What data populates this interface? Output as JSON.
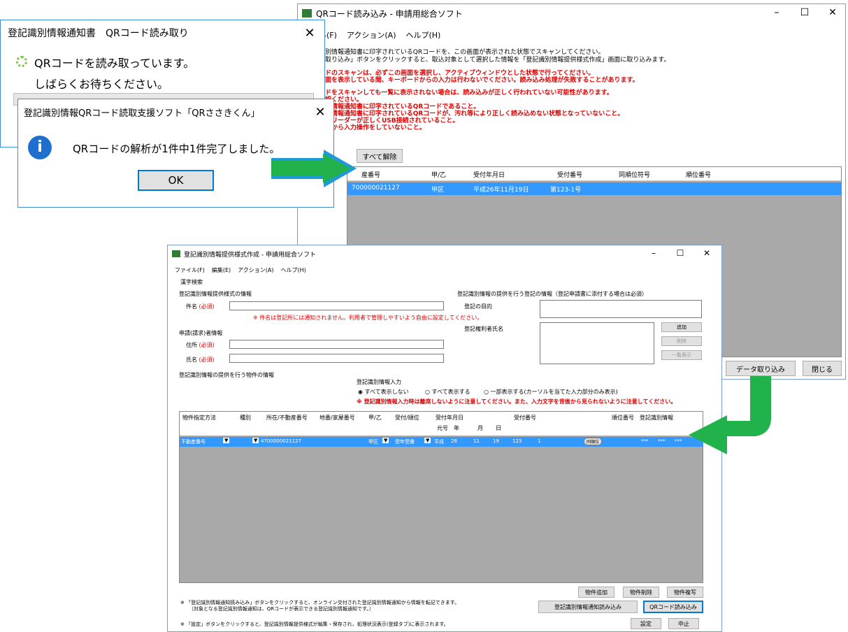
{
  "qr_window": {
    "title": "QRコード読み込み - 申請用総合ソフト",
    "menu": [
      "ル(F)",
      "アクション(A)",
      "ヘルプ(H)"
    ],
    "instructions": [
      "識別情報通知書に印字されているQRコードを、この画面が表示された状態でスキャンしてください。",
      "タ取り込み」ボタンをクリックすると、取込対象として選択した情報を「登記識別情報提供様式作成」画面に取り込みます。"
    ],
    "warnings": [
      "ードのスキャンは、必ずこの画面を選択し、アクティブウィンドウとした状態で行ってください。",
      "画面を表示している間、キーボードからの入力は行わないでください。読み込み処理が失敗することがあります。",
      "ードをスキャンしても一覧に表示されない場合は、読み込みが正しく行われていない可能性があります。",
      "確認ください。",
      "識別情報通知書に印字されているQRコードであること。",
      "識別情報通知書に印字されているQRコードが、汚れ等により正しく読み込めない状態となっていないこと。",
      "ードリーダーが正しくUSB接続されていること。",
      "ードから入力操作をしていないこと。"
    ],
    "unselect_all": "すべて解除",
    "columns": [
      "産番号",
      "甲/乙",
      "受付年月日",
      "受付番号",
      "同順位符号",
      "順位番号"
    ],
    "row": [
      "700000021127",
      "甲区",
      "平成26年11月19日",
      "第123-1号",
      "",
      ""
    ],
    "import_button": "データ取り込み",
    "close_button": "閉じる"
  },
  "progress_dialog": {
    "title": "登記識別情報通知書　QRコード読み取り",
    "line1": "QRコードを読み取っています。",
    "line2": "しばらくお待ちください。"
  },
  "msg_dialog": {
    "title": "登記識別情報QRコード読取支援ソフト「QRささきくん」",
    "message": "QRコードの解析が1件中1件完了しました。",
    "ok": "OK"
  },
  "form_window": {
    "title": "登記識別情報提供様式作成 - 申請用総合ソフト",
    "menu": [
      "ファイル(F)",
      "編集(E)",
      "アクション(A)",
      "ヘルプ(H)"
    ],
    "kanji_search": "漢字検索",
    "section_info": "登記識別情報提供様式の情報",
    "label_name": "件名",
    "required": "(必須)",
    "note_name": "※ 件名は登記所には通知されません。利用者で管理しやすいよう自由に設定してください。",
    "section_applicant": "申請(請求)者情報",
    "label_address": "住所",
    "label_person": "氏名",
    "section_reg": "登記識別情報の提供を行う登記の情報（登記申請書に添付する場合は必須）",
    "label_purpose": "登記の目的",
    "label_holder": "登記権利者氏名",
    "add_small": "追加",
    "delete_small": "削除",
    "list_view": "一覧表示",
    "section_property": "登記識別情報の提供を行う物件の情報",
    "input_title": "登記識別情報入力",
    "radio1": "すべて表示しない",
    "radio2": "すべて表示する",
    "radio3": "一部表示する(カーソルを当てた入力部分のみ表示)",
    "input_warning": "※ 登記識別情報入力時は離席しないように注意してください。また、入力文字を背後から見られないように注意してください。",
    "columns": [
      "物件指定方法",
      "種別",
      "所在/不動産番号",
      "地番/家屋番号",
      "甲/乙",
      "受付/順位",
      "受付年月日",
      "受付番号",
      "順位番号",
      "登記識別情報"
    ],
    "subcolumns": [
      "元号",
      "年",
      "月",
      "日"
    ],
    "row": {
      "method": "不動産番号",
      "number": "4700000021127",
      "kou": "甲区",
      "uketsuke": "受年受番",
      "era": "平成",
      "year": "26",
      "month": "11",
      "day": "19",
      "recno1": "123",
      "recno2": "1",
      "same": "同順位",
      "code1": "***",
      "code2": "***",
      "code3": "***"
    },
    "btn_add": "物件追加",
    "btn_del": "物件削除",
    "btn_copy": "物件複写",
    "btn_import_notice": "登記識別情報通知読み込み",
    "btn_qr": "QRコード読み込み",
    "note1": "※ 「登記識別情報通知読み込み」ボタンをクリックすると、オンライン交付された登記識別情報通知から情報を転記できます。",
    "note1b": "（対象となる登記識別情報通知は、QRコードが表示できる登記識別情報通知です。）",
    "note2": "※ 「設定」ボタンをクリックすると、登記識別情報提供様式が編集・保存され、処理状況表示(登録タブ)に表示されます。",
    "btn_set": "設定",
    "btn_cancel": "中止"
  },
  "colors": {
    "arrow_blue": "#1f9ad6",
    "arrow_green": "#21b24b",
    "selection": "#3399ff",
    "warning": "#e00000"
  }
}
